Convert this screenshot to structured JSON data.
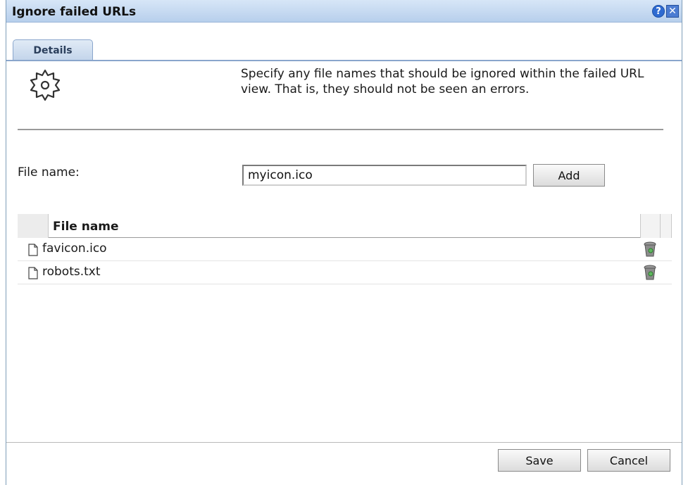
{
  "dialog": {
    "title": "Ignore failed URLs",
    "help_icon": "help-icon",
    "close_icon": "close-icon"
  },
  "tabs": [
    {
      "label": "Details",
      "selected": true
    }
  ],
  "intro": {
    "icon": "gear-icon",
    "description": "Specify any file names that should be ignored within the failed URL view. That is, they should not be seen an errors."
  },
  "form": {
    "file_name_label": "File name:",
    "file_name_value": "myicon.ico",
    "add_label": "Add"
  },
  "table": {
    "column_header": "File name",
    "rows": [
      {
        "name": "favicon.ico",
        "icon": "file-icon",
        "action_icon": "trash-icon"
      },
      {
        "name": "robots.txt",
        "icon": "file-icon",
        "action_icon": "trash-icon"
      }
    ]
  },
  "footer": {
    "save_label": "Save",
    "cancel_label": "Cancel"
  }
}
